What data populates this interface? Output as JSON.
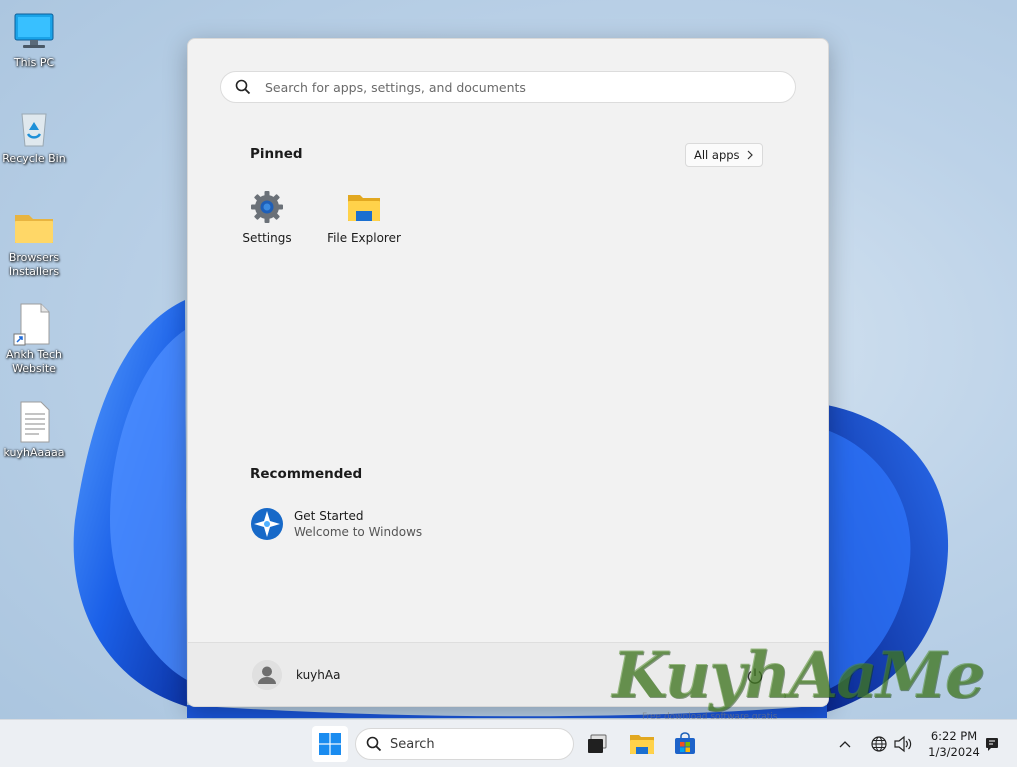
{
  "desktop": {
    "icons": [
      {
        "label": "This PC"
      },
      {
        "label": "Recycle Bin"
      },
      {
        "label": "Browsers Installers"
      },
      {
        "label": "Ankh Tech Website"
      },
      {
        "label": "kuyhAaaaa"
      }
    ]
  },
  "start_menu": {
    "search_placeholder": "Search for apps, settings, and documents",
    "pinned_title": "Pinned",
    "all_apps_label": "All apps",
    "pinned": [
      {
        "label": "Settings",
        "icon": "gear-icon"
      },
      {
        "label": "File Explorer",
        "icon": "folder-icon"
      }
    ],
    "recommended_title": "Recommended",
    "recommended": [
      {
        "title": "Get Started",
        "subtitle": "Welcome to Windows",
        "icon": "get-started-icon"
      }
    ],
    "user_name": "kuyhAa"
  },
  "watermark": {
    "text": "KuyhAaMe",
    "tagline": "Free download software gratis"
  },
  "taskbar": {
    "search_label": "Search",
    "time": "6:22 PM",
    "date": "1/3/2024"
  },
  "colors": {
    "accent": "#0067c0",
    "wallpaper_blue": "#1a5fe0"
  }
}
